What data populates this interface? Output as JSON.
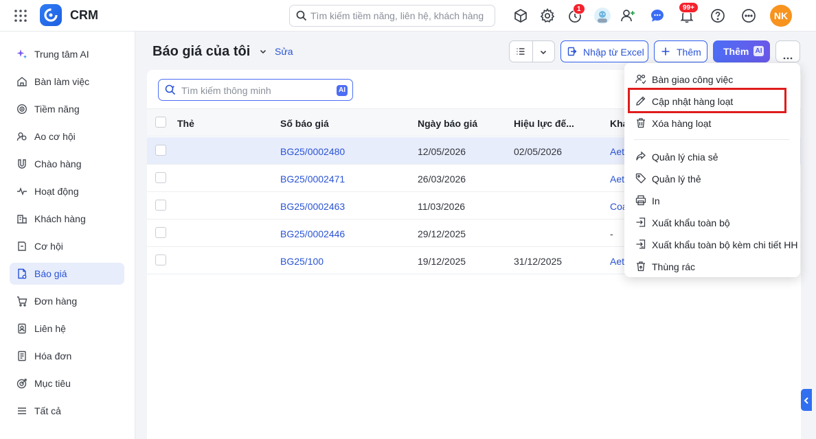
{
  "app": {
    "name": "CRM"
  },
  "header": {
    "search_placeholder": "Tìm kiếm tiềm năng, liên hệ, khách hàng",
    "timer_badge": "1",
    "notification_badge": "99+",
    "user_initials": "NK"
  },
  "sidebar": {
    "items": [
      {
        "label": "Trung tâm AI",
        "icon": "sparkle-icon"
      },
      {
        "label": "Bàn làm việc",
        "icon": "home-icon"
      },
      {
        "label": "Tiềm năng",
        "icon": "target-icon"
      },
      {
        "label": "Ao cơ hội",
        "icon": "users-icon"
      },
      {
        "label": "Chào hàng",
        "icon": "magnet-icon"
      },
      {
        "label": "Hoạt động",
        "icon": "pulse-icon"
      },
      {
        "label": "Khách hàng",
        "icon": "building-icon"
      },
      {
        "label": "Cơ hội",
        "icon": "tag-icon"
      },
      {
        "label": "Báo giá",
        "icon": "document-icon",
        "active": true
      },
      {
        "label": "Đơn hàng",
        "icon": "cart-icon"
      },
      {
        "label": "Liên hệ",
        "icon": "contact-icon"
      },
      {
        "label": "Hóa đơn",
        "icon": "invoice-icon"
      },
      {
        "label": "Mục tiêu",
        "icon": "goal-icon"
      },
      {
        "label": "Tất cả",
        "icon": "menu-icon"
      }
    ]
  },
  "page": {
    "title": "Báo giá của tôi",
    "edit_label": "Sửa",
    "import_label": "Nhập từ Excel",
    "add_label": "Thêm",
    "add_ai_label": "Thêm",
    "ai_tag": "AI"
  },
  "table": {
    "smart_search_placeholder": "Tìm kiếm thông minh",
    "ai_tag": "AI",
    "columns": [
      "Thẻ",
      "Số báo giá",
      "Ngày báo giá",
      "Hiệu lực đế...",
      "Kha"
    ],
    "rows": [
      {
        "tag": "",
        "number": "BG25/0002480",
        "date": "12/05/2026",
        "valid_until": "02/05/2026",
        "customer": "Aet",
        "selected": true
      },
      {
        "tag": "",
        "number": "BG25/0002471",
        "date": "26/03/2026",
        "valid_until": "",
        "customer": "Aet"
      },
      {
        "tag": "",
        "number": "BG25/0002463",
        "date": "11/03/2026",
        "valid_until": "",
        "customer": "Coa"
      },
      {
        "tag": "",
        "number": "BG25/0002446",
        "date": "29/12/2025",
        "valid_until": "",
        "customer": "-"
      },
      {
        "tag": "",
        "number": "BG25/100",
        "date": "19/12/2025",
        "valid_until": "31/12/2025",
        "customer": "Aet"
      }
    ]
  },
  "dropdown": {
    "items": [
      {
        "label": "Bàn giao công việc",
        "icon": "handover-icon"
      },
      {
        "label": "Cập nhật hàng loạt",
        "icon": "pencil-icon",
        "highlighted": true
      },
      {
        "label": "Xóa hàng loạt",
        "icon": "trash-icon"
      },
      {
        "label": "Quản lý chia sẻ",
        "icon": "share-icon"
      },
      {
        "label": "Quản lý thẻ",
        "icon": "tag-icon"
      },
      {
        "label": "In",
        "icon": "printer-icon"
      },
      {
        "label": "Xuất khẩu toàn bộ",
        "icon": "export-icon"
      },
      {
        "label": "Xuất khẩu toàn bộ kèm chi tiết HH",
        "icon": "export-detail-icon"
      },
      {
        "label": "Thùng rác",
        "icon": "recycle-bin-icon"
      }
    ]
  },
  "colors": {
    "accent": "#2953d6",
    "highlight": "#e01b1b",
    "badge": "#f5222d",
    "avatar": "#f7931e"
  }
}
